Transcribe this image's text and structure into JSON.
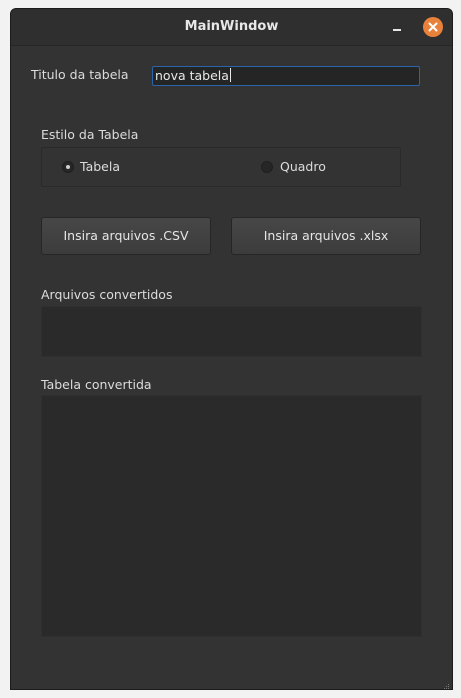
{
  "window": {
    "title": "MainWindow",
    "controls": [
      "minimize-icon",
      "close-icon"
    ]
  },
  "title_field": {
    "label": "Titulo da tabela",
    "value": "nova tabela"
  },
  "style_group": {
    "label": "Estilo da Tabela",
    "options": [
      {
        "label": "Tabela",
        "checked": true
      },
      {
        "label": "Quadro",
        "checked": false
      }
    ]
  },
  "buttons": {
    "csv_label": "Insira arquivos .CSV",
    "xlsx_label": "Insira arquivos .xlsx"
  },
  "converted_files": {
    "label": "Arquivos convertidos"
  },
  "converted_table": {
    "label": "Tabela convertida"
  },
  "colors": {
    "window_bg": "#333333",
    "field_bg": "#2a2a2a",
    "focus_border": "#2d63a8",
    "close_button": "#e8823b"
  }
}
